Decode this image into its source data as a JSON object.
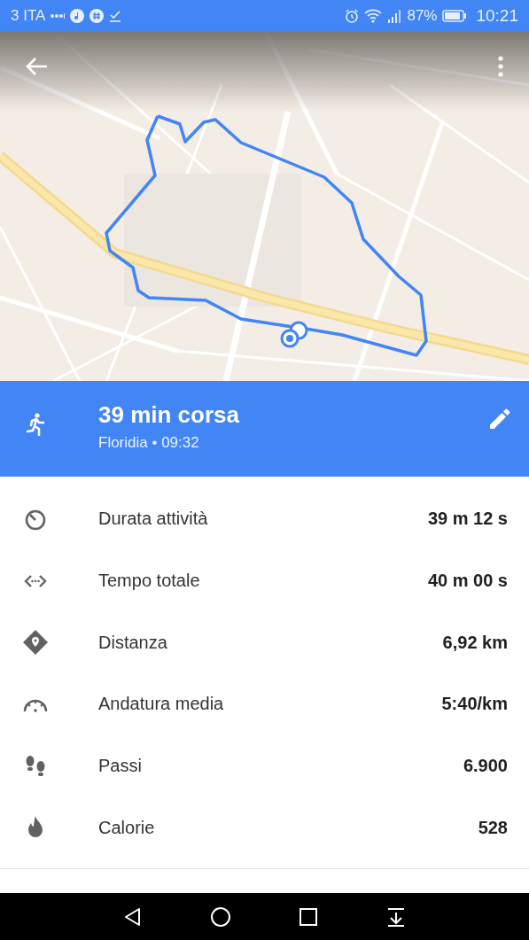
{
  "status_bar": {
    "carrier": "3 ITA",
    "battery": "87%",
    "time": "10:21"
  },
  "activity": {
    "title": "39 min corsa",
    "subtitle": "Floridia • 09:32"
  },
  "stats": [
    {
      "kind": "timer",
      "label": "Durata attività",
      "value": "39 m 12 s"
    },
    {
      "kind": "span",
      "label": "Tempo totale",
      "value": "40 m 00 s"
    },
    {
      "kind": "distance",
      "label": "Distanza",
      "value": "6,92 km"
    },
    {
      "kind": "pace",
      "label": "Andatura media",
      "value": "5:40/km"
    },
    {
      "kind": "steps",
      "label": "Passi",
      "value": "6.900"
    },
    {
      "kind": "calories",
      "label": "Calorie",
      "value": "528"
    }
  ]
}
